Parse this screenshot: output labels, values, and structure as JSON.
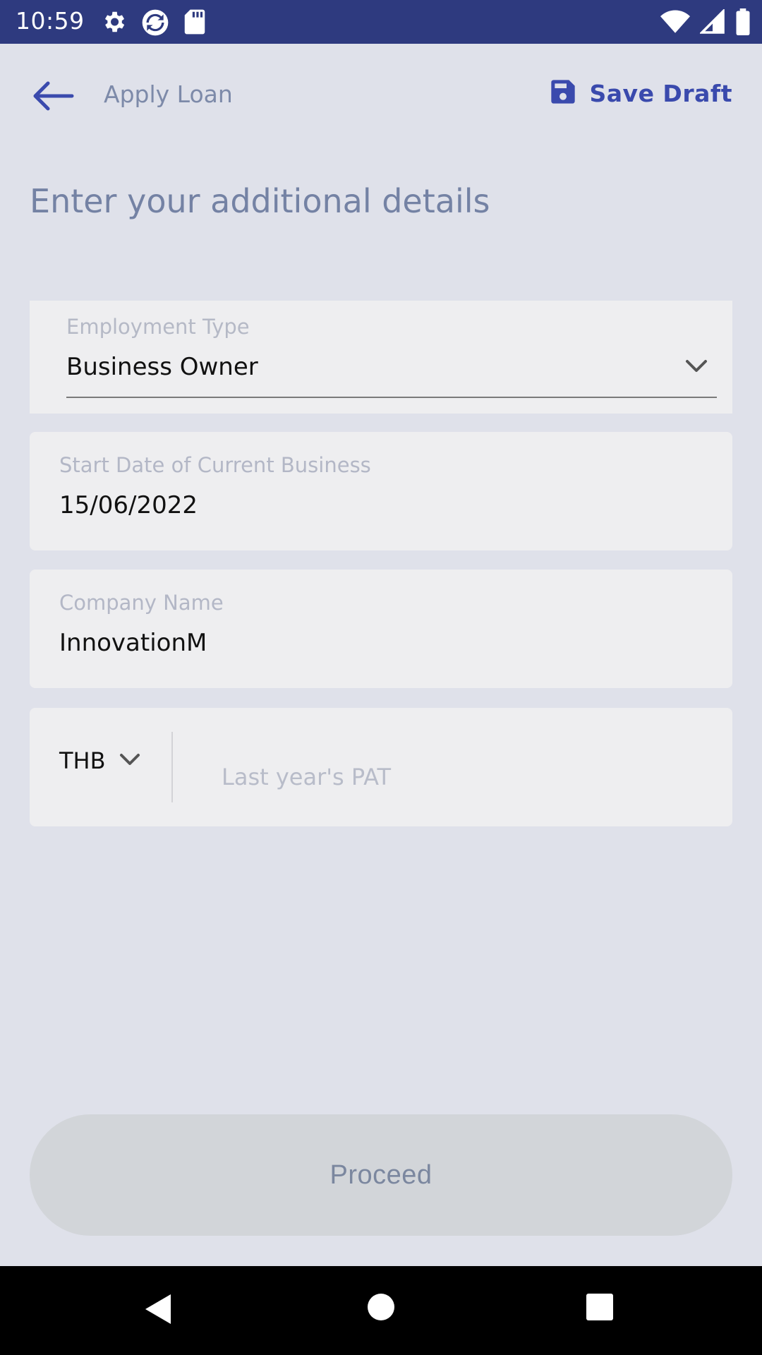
{
  "status_bar": {
    "time": "10:59",
    "left_icons": [
      "gear-icon",
      "sync-icon",
      "sd-card-icon"
    ],
    "right_icons": [
      "wifi-icon",
      "signal-icon",
      "battery-icon"
    ]
  },
  "header": {
    "back_icon": "arrow-left-icon",
    "title": "Apply Loan",
    "save_icon": "floppy-disk-icon",
    "save_label": "Save Draft",
    "accent_color": "#3a4aad"
  },
  "page": {
    "heading": "Enter your additional details"
  },
  "form": {
    "employment_type": {
      "label": "Employment Type",
      "value": "Business Owner"
    },
    "start_date": {
      "label": "Start Date of Current Business",
      "value": "15/06/2022"
    },
    "company_name": {
      "label": "Company Name",
      "value": "InnovationM"
    },
    "pat": {
      "currency": "THB",
      "placeholder": "Last year's PAT"
    }
  },
  "proceed_label": "Proceed",
  "nav_bar": {
    "icons": [
      "triangle-back-icon",
      "circle-home-icon",
      "square-recents-icon"
    ]
  }
}
